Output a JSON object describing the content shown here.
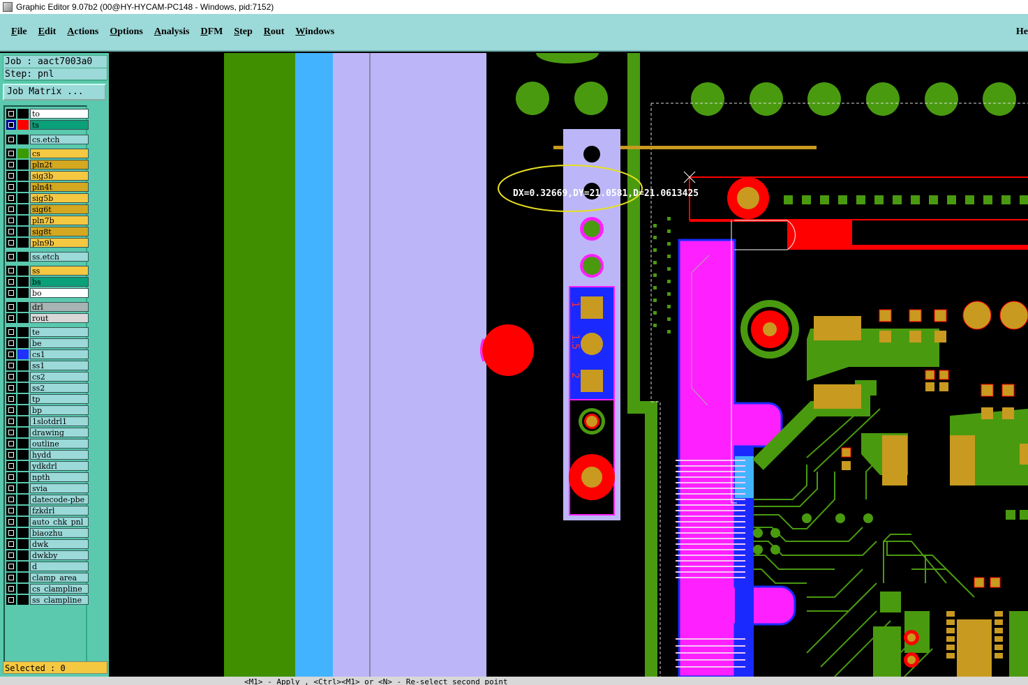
{
  "window": {
    "title": "Graphic Editor 9.07b2 (00@HY-HYCAM-PC148 - Windows, pid:7152)"
  },
  "menu": {
    "items": [
      {
        "label": "File",
        "u": "F",
        "rest": "ile"
      },
      {
        "label": "Edit",
        "u": "E",
        "rest": "dit"
      },
      {
        "label": "Actions",
        "u": "A",
        "rest": "ctions"
      },
      {
        "label": "Options",
        "u": "O",
        "rest": "ptions"
      },
      {
        "label": "Analysis",
        "u": "A",
        "rest": "nalysis"
      },
      {
        "label": "DFM",
        "u": "D",
        "rest": "FM"
      },
      {
        "label": "Step",
        "u": "S",
        "rest": "tep"
      },
      {
        "label": "Rout",
        "u": "R",
        "rest": "out"
      },
      {
        "label": "Windows",
        "u": "W",
        "rest": "indows"
      }
    ],
    "help": "He"
  },
  "job": {
    "job_line": "Job : aact7003a0",
    "step_line": "Step: pnl",
    "matrix_button": "Job Matrix ..."
  },
  "layers": [
    {
      "name": "to",
      "bg": "#ffffff",
      "swatch": "#000000",
      "check": "#000000"
    },
    {
      "name": "ts",
      "bg": "#0aa07a",
      "swatch": "#ff0000",
      "check": "#0000a0"
    },
    {
      "name": "cs.etch",
      "bg": "#9cd9d9",
      "swatch": "#000000",
      "check": "#000000"
    },
    {
      "name": "cs",
      "bg": "#f5c842",
      "swatch": "#3a9a00",
      "check": "#000000"
    },
    {
      "name": "pln2t",
      "bg": "#d4a820",
      "swatch": "#000000",
      "check": "#000000"
    },
    {
      "name": "sig3b",
      "bg": "#f5c842",
      "swatch": "#000000",
      "check": "#000000"
    },
    {
      "name": "pln4t",
      "bg": "#d4a820",
      "swatch": "#000000",
      "check": "#000000"
    },
    {
      "name": "sig5b",
      "bg": "#f5c842",
      "swatch": "#000000",
      "check": "#000000"
    },
    {
      "name": "sig6t",
      "bg": "#d4a820",
      "swatch": "#000000",
      "check": "#000000"
    },
    {
      "name": "pln7b",
      "bg": "#f5c842",
      "swatch": "#000000",
      "check": "#000000"
    },
    {
      "name": "sig8t",
      "bg": "#d4a820",
      "swatch": "#000000",
      "check": "#000000"
    },
    {
      "name": "pln9b",
      "bg": "#f5c842",
      "swatch": "#000000",
      "check": "#000000"
    },
    {
      "name": "ss.etch",
      "bg": "#9cd9d9",
      "swatch": "#000000",
      "check": "#000000"
    },
    {
      "name": "ss",
      "bg": "#f5c842",
      "swatch": "#000000",
      "check": "#000000"
    },
    {
      "name": "bs",
      "bg": "#0aa07a",
      "swatch": "#000000",
      "check": "#000000"
    },
    {
      "name": "bo",
      "bg": "#ffffff",
      "swatch": "#000000",
      "check": "#000000"
    },
    {
      "name": "drl",
      "bg": "#a8b4b4",
      "swatch": "#000000",
      "check": "#000000"
    },
    {
      "name": "rout",
      "bg": "#d8d8d8",
      "swatch": "#000000",
      "check": "#000000"
    },
    {
      "name": "te",
      "bg": "#9cd9d9",
      "swatch": "#000000",
      "check": "#000000"
    },
    {
      "name": "be",
      "bg": "#9cd9d9",
      "swatch": "#000000",
      "check": "#000000"
    },
    {
      "name": "cs1",
      "bg": "#9cd9d9",
      "swatch": "#2030ff",
      "check": "#000000"
    },
    {
      "name": "ss1",
      "bg": "#9cd9d9",
      "swatch": "#000000",
      "check": "#000000"
    },
    {
      "name": "cs2",
      "bg": "#9cd9d9",
      "swatch": "#000000",
      "check": "#000000"
    },
    {
      "name": "ss2",
      "bg": "#9cd9d9",
      "swatch": "#000000",
      "check": "#000000"
    },
    {
      "name": "tp",
      "bg": "#9cd9d9",
      "swatch": "#000000",
      "check": "#000000"
    },
    {
      "name": "bp",
      "bg": "#9cd9d9",
      "swatch": "#000000",
      "check": "#000000"
    },
    {
      "name": "1slotdrl1",
      "bg": "#9cd9d9",
      "swatch": "#000000",
      "check": "#000000"
    },
    {
      "name": "drawing",
      "bg": "#9cd9d9",
      "swatch": "#000000",
      "check": "#000000"
    },
    {
      "name": "outline",
      "bg": "#9cd9d9",
      "swatch": "#000000",
      "check": "#000000"
    },
    {
      "name": "hydd",
      "bg": "#9cd9d9",
      "swatch": "#000000",
      "check": "#000000"
    },
    {
      "name": "ydkdrl",
      "bg": "#9cd9d9",
      "swatch": "#000000",
      "check": "#000000"
    },
    {
      "name": "npth",
      "bg": "#9cd9d9",
      "swatch": "#000000",
      "check": "#000000"
    },
    {
      "name": "svia",
      "bg": "#9cd9d9",
      "swatch": "#000000",
      "check": "#000000"
    },
    {
      "name": "datecode-pbe",
      "bg": "#9cd9d9",
      "swatch": "#000000",
      "check": "#000000"
    },
    {
      "name": "fzkdrl",
      "bg": "#9cd9d9",
      "swatch": "#000000",
      "check": "#000000"
    },
    {
      "name": "auto_chk_pnl",
      "bg": "#9cd9d9",
      "swatch": "#000000",
      "check": "#000000"
    },
    {
      "name": "biaozhu",
      "bg": "#9cd9d9",
      "swatch": "#000000",
      "check": "#000000"
    },
    {
      "name": "dwk",
      "bg": "#9cd9d9",
      "swatch": "#000000",
      "check": "#000000"
    },
    {
      "name": "dwkby",
      "bg": "#9cd9d9",
      "swatch": "#000000",
      "check": "#000000"
    },
    {
      "name": "d",
      "bg": "#9cd9d9",
      "swatch": "#000000",
      "check": "#000000"
    },
    {
      "name": "clamp_area",
      "bg": "#9cd9d9",
      "swatch": "#000000",
      "check": "#000000"
    },
    {
      "name": "cs_clampline",
      "bg": "#9cd9d9",
      "swatch": "#000000",
      "check": "#000000"
    },
    {
      "name": "ss_clampline",
      "bg": "#9cd9d9",
      "swatch": "#000000",
      "check": "#000000"
    }
  ],
  "selected": "Selected : 0",
  "status": {
    "message": "<M1> - Apply , <Ctrl><M1> or <N> - Re-select second point"
  },
  "canvas": {
    "measure_text": "DX=0.32669,DY=21.0581,D=21.0613425",
    "pad_labels": [
      "1",
      "1.5",
      "2"
    ]
  }
}
